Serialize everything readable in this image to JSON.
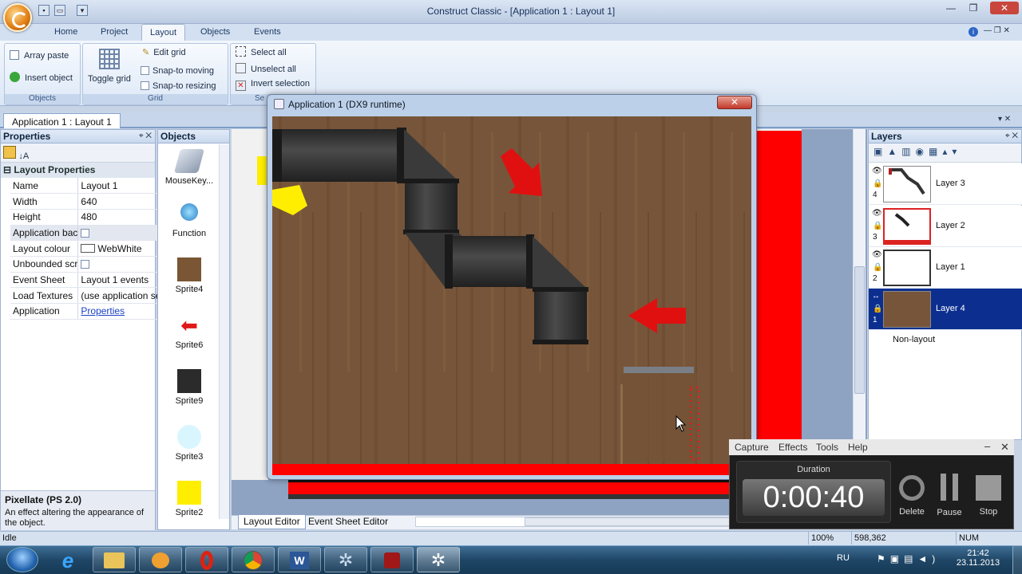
{
  "window": {
    "title": "Construct Classic - [Application 1 : Layout 1]"
  },
  "ribbon": {
    "tabs": [
      "Home",
      "Project",
      "Layout",
      "Objects",
      "Events"
    ],
    "active_tab": "Layout",
    "groups": {
      "objects": {
        "caption": "Objects",
        "array_paste": "Array paste",
        "insert_object": "Insert object"
      },
      "grid": {
        "caption": "Grid",
        "toggle_grid": "Toggle grid",
        "edit_grid": "Edit grid",
        "snap_moving": "Snap-to moving",
        "snap_resizing": "Snap-to resizing"
      },
      "selection": {
        "caption": "Se",
        "select_all": "Select all",
        "unselect_all": "Unselect all",
        "invert_selection": "Invert selection"
      }
    }
  },
  "doc_tab": "Application 1 : Layout 1",
  "properties": {
    "title": "Properties",
    "section": "Layout Properties",
    "rows": [
      {
        "key": "Name",
        "value": "Layout 1"
      },
      {
        "key": "Width",
        "value": "640"
      },
      {
        "key": "Height",
        "value": "480"
      },
      {
        "key": "Application bac",
        "value": ""
      },
      {
        "key": "Layout colour",
        "value": "WebWhite"
      },
      {
        "key": "Unbounded scr",
        "value": ""
      },
      {
        "key": "Event Sheet",
        "value": "Layout 1 events"
      },
      {
        "key": "Load Textures",
        "value": "(use application se"
      },
      {
        "key": "Application",
        "value": "Properties"
      }
    ],
    "help_title": "Pixellate (PS 2.0)",
    "help_text": "An effect altering the appearance of the object."
  },
  "objects": {
    "title": "Objects",
    "items": [
      "MouseKey...",
      "Function",
      "Sprite4",
      "Sprite6",
      "Sprite9",
      "Sprite3",
      "Sprite2"
    ]
  },
  "editor_tabs": [
    "Layout Editor",
    "Event Sheet Editor"
  ],
  "runtime": {
    "title": "Application 1 (DX9 runtime)"
  },
  "layers": {
    "title": "Layers",
    "items": [
      {
        "num": "4",
        "name": "Layer 3"
      },
      {
        "num": "3",
        "name": "Layer 2"
      },
      {
        "num": "2",
        "name": "Layer 1"
      },
      {
        "num": "1",
        "name": "Layer 4"
      }
    ],
    "non_layout": "Non-layout"
  },
  "recorder": {
    "menu": [
      "Capture",
      "Effects",
      "Tools",
      "Help"
    ],
    "duration_label": "Duration",
    "time": "0:00:40",
    "buttons": [
      "Delete",
      "Pause",
      "Stop"
    ]
  },
  "status": {
    "left": "Idle",
    "zoom": "100%",
    "coords": "598,362",
    "num": "NUM"
  },
  "taskbar": {
    "lang": "RU",
    "time": "21:42",
    "date": "23.11.2013"
  }
}
